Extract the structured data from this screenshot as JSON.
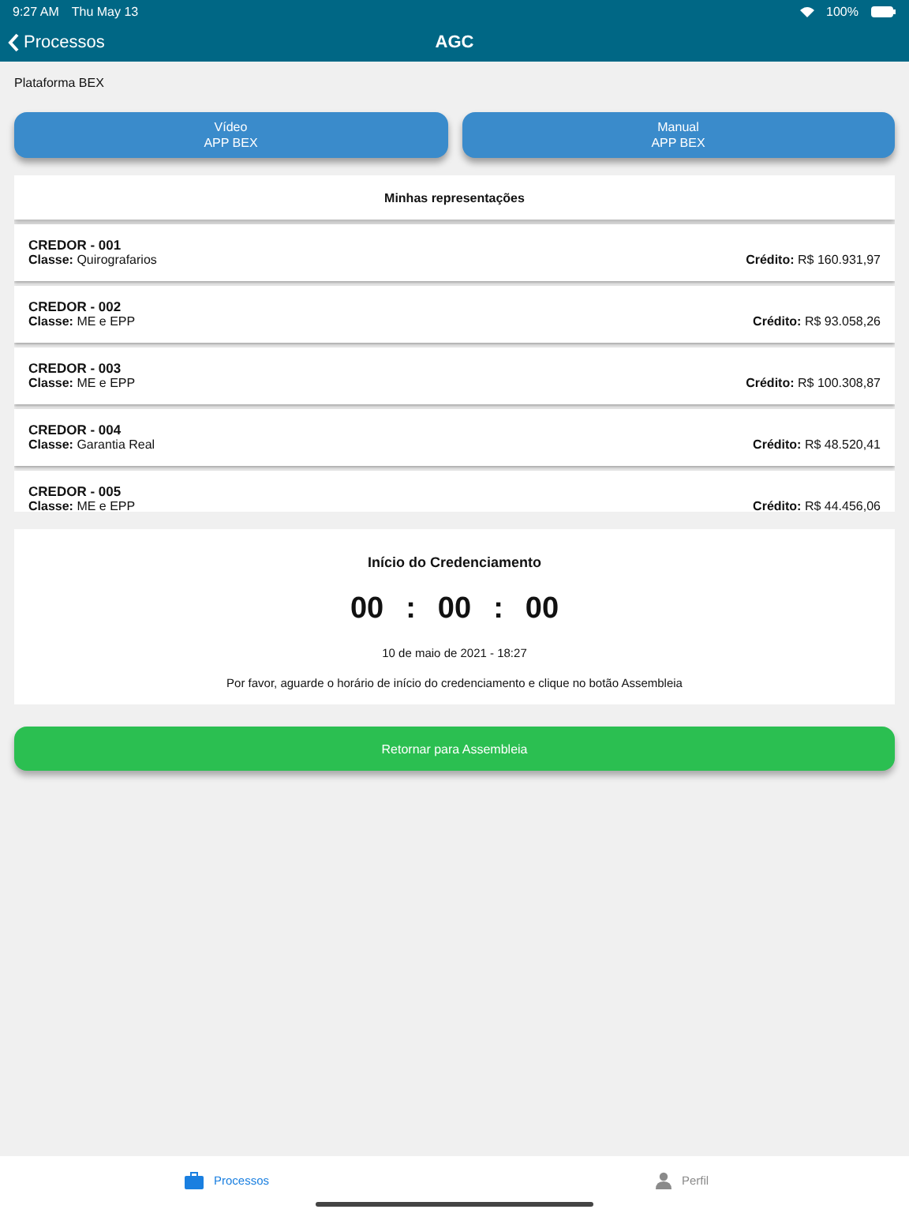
{
  "status_bar": {
    "time": "9:27 AM",
    "date": "Thu May 13",
    "battery": "100%"
  },
  "nav": {
    "back": "Processos",
    "title": "AGC"
  },
  "platform": "Plataforma BEX",
  "buttons": [
    {
      "line1": "Vídeo",
      "line2": "APP BEX"
    },
    {
      "line1": "Manual",
      "line2": "APP BEX"
    }
  ],
  "list": {
    "title": "Minhas representações",
    "rows": [
      {
        "name": "CREDOR - 001",
        "class_label": "Classe:",
        "class_value": "Quirografarios",
        "credit_label": "Crédito:",
        "credit_value": "R$ 160.931,97"
      },
      {
        "name": "CREDOR - 002",
        "class_label": "Classe:",
        "class_value": "ME e EPP",
        "credit_label": "Crédito:",
        "credit_value": "R$ 93.058,26"
      },
      {
        "name": "CREDOR - 003",
        "class_label": "Classe:",
        "class_value": "ME e EPP",
        "credit_label": "Crédito:",
        "credit_value": "R$ 100.308,87"
      },
      {
        "name": "CREDOR - 004",
        "class_label": "Classe:",
        "class_value": "Garantia Real",
        "credit_label": "Crédito:",
        "credit_value": "R$ 48.520,41"
      },
      {
        "name": "CREDOR - 005",
        "class_label": "Classe:",
        "class_value": "ME e EPP",
        "credit_label": "Crédito:",
        "credit_value": "R$ 44.456,06"
      }
    ]
  },
  "countdown": {
    "title": "Início do Credenciamento",
    "hours": "00",
    "minutes": "00",
    "seconds": "00",
    "separator": ":",
    "date": "10 de maio de 2021 - 18:27",
    "message": "Por favor, aguarde o horário de início do credenciamento e clique no botão Assembleia"
  },
  "return_button": "Retornar para Assembleia",
  "tab_bar": [
    {
      "label": "Processos",
      "kind": "briefcase",
      "selected": true
    },
    {
      "label": "Perfil",
      "kind": "person",
      "selected": false
    }
  ]
}
